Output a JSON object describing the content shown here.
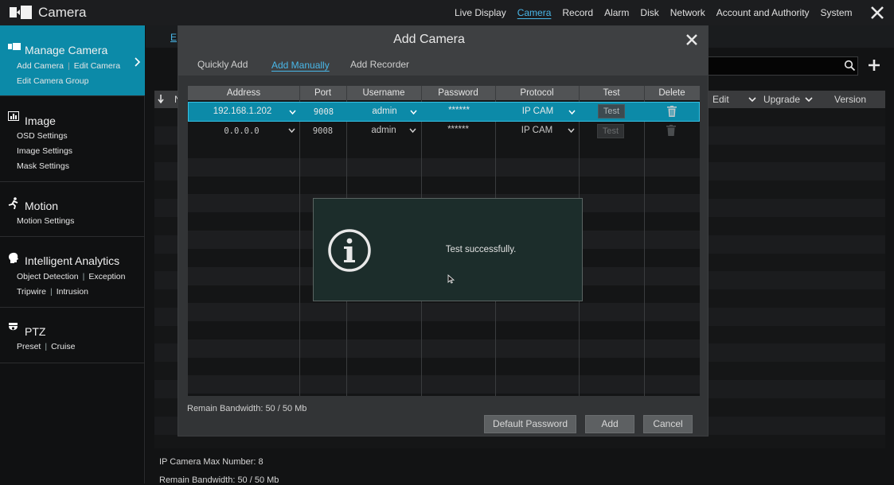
{
  "app": {
    "title": "Camera",
    "nav": [
      "Live Display",
      "Camera",
      "Record",
      "Alarm",
      "Disk",
      "Network",
      "Account and Authority",
      "System"
    ],
    "active_nav": "Camera"
  },
  "sidebar": {
    "manage_camera": {
      "title": "Manage Camera",
      "line1": [
        "Add Camera",
        "Edit Camera"
      ],
      "line2": "Edit Camera Group"
    },
    "image": {
      "title": "Image",
      "items": [
        "OSD Settings",
        "Image Settings",
        "Mask Settings"
      ]
    },
    "motion": {
      "title": "Motion",
      "items": [
        "Motion Settings"
      ]
    },
    "intelligent_analytics": {
      "title": "Intelligent Analytics",
      "line1": [
        "Object Detection",
        "Exception"
      ],
      "line2": [
        "Tripwire",
        "Intrusion"
      ]
    },
    "ptz": {
      "title": "PTZ",
      "line1": [
        "Preset",
        "Cruise"
      ]
    }
  },
  "background": {
    "tab_fragment": "E",
    "columns": {
      "col_n": "N",
      "edit": "Edit",
      "upgrade": "Upgrade",
      "version": "Version"
    },
    "max_number": "IP Camera Max Number: 8",
    "remain_bandwidth": "Remain Bandwidth: 50 / 50 Mb"
  },
  "dialog": {
    "title": "Add Camera",
    "tabs": [
      "Quickly Add",
      "Add Manually",
      "Add Recorder"
    ],
    "active_tab": "Add Manually",
    "columns": [
      "Address",
      "Port",
      "Username",
      "Password",
      "Protocol",
      "Test",
      "Delete"
    ],
    "rows": [
      {
        "address": "192.168.1.202",
        "port": "9008",
        "username": "admin",
        "password": "******",
        "protocol": "IP CAM",
        "test": "Test",
        "selected": true
      },
      {
        "address": "0.0.0.0",
        "port": "9008",
        "username": "admin",
        "password": "******",
        "protocol": "IP CAM",
        "test": "Test",
        "selected": false
      }
    ],
    "remain_bandwidth": "Remain Bandwidth: 50 / 50 Mb",
    "buttons": {
      "default_password": "Default Password",
      "add": "Add",
      "cancel": "Cancel"
    }
  },
  "popup": {
    "message": "Test successfully."
  },
  "colors": {
    "accent": "#0c8aa8",
    "link": "#49b7e8",
    "popup_bg": "#1c2d2b"
  },
  "icons": [
    "camera-logo-icon",
    "close-icon",
    "chevron-right-icon",
    "image-icon",
    "motion-icon",
    "analytics-head-icon",
    "ptz-dome-icon",
    "search-icon",
    "plus-icon",
    "chevron-down-icon",
    "trash-icon",
    "info-icon",
    "mouse-cursor-icon"
  ]
}
